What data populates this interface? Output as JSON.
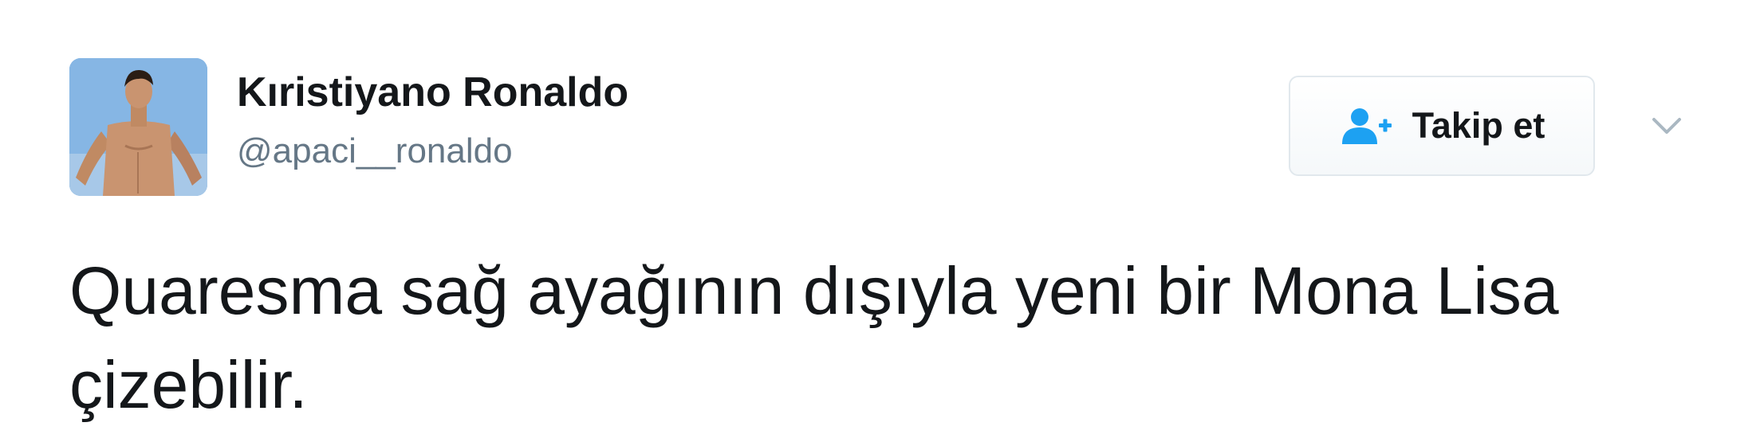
{
  "tweet": {
    "author": {
      "display_name": "Kıristiyano Ronaldo",
      "handle": "@apaci__ronaldo",
      "avatar_icon": "profile-photo"
    },
    "follow_button": {
      "label": "Takip et",
      "icon": "user-plus-icon"
    },
    "menu_icon": "chevron-down-icon",
    "text": "Quaresma sağ ayağının dışıyla yeni bir Mona Lisa çizebilir."
  },
  "colors": {
    "text_primary": "#14171a",
    "text_secondary": "#657786",
    "accent": "#1da1f2",
    "button_border": "#e1e8ed"
  }
}
